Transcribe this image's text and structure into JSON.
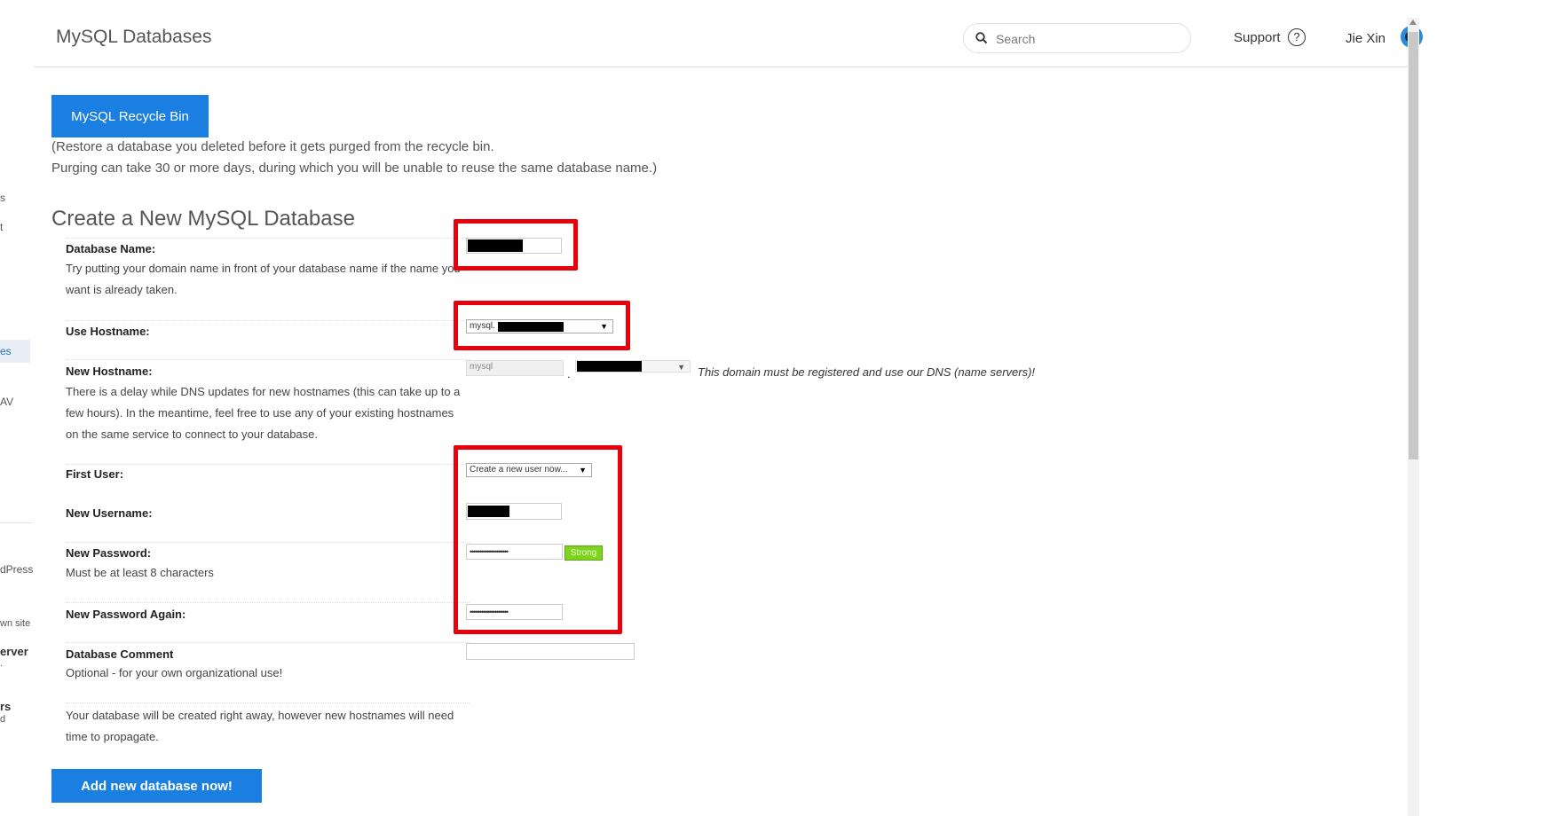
{
  "header": {
    "page_title": "MySQL Databases",
    "search_placeholder": "Search",
    "support_label": "Support",
    "support_icon_glyph": "?",
    "user_name": "Jie Xin"
  },
  "sidebar_fragments": [
    "s",
    "t",
    "es",
    "AV",
    "dPress",
    "wn site",
    "erver",
    ".",
    "rs",
    "d"
  ],
  "recycle": {
    "button_label": "MySQL Recycle Bin",
    "line1": "(Restore a database you deleted before it gets purged from the recycle bin.",
    "line2": "Purging can take 30 or more days, during which you will be unable to reuse the same database name.)"
  },
  "form": {
    "section_title": "Create a New MySQL Database",
    "database_name": {
      "label": "Database Name:",
      "help": "Try putting your domain name in front of your database name if the name you want is already taken."
    },
    "use_hostname": {
      "label": "Use Hostname:",
      "selected": "mysql."
    },
    "new_hostname": {
      "label": "New Hostname:",
      "help": "There is a delay while DNS updates for new hostnames (this can take up to a few hours). In the meantime, feel free to use any of your existing hostnames on the same service to connect to your database.",
      "prefix_value": "mysql",
      "dot": ".",
      "note": "This domain must be registered and use our DNS (name servers)!"
    },
    "first_user": {
      "label": "First User:",
      "selected": "Create a new user now..."
    },
    "new_username": {
      "label": "New Username:"
    },
    "new_password": {
      "label": "New Password:",
      "help": "Must be at least 8 characters",
      "value": "••••••••••••••••••••",
      "strength": "Strong"
    },
    "new_password_again": {
      "label": "New Password Again:",
      "value": "••••••••••••••••••••"
    },
    "database_comment": {
      "label": "Database Comment",
      "help": "Optional - for your own organizational use!",
      "value": ""
    },
    "footer_note": "Your database will be created right away, however new hostnames will need time to propagate.",
    "submit_label": "Add new database now!"
  },
  "colors": {
    "accent": "#1a7fe0",
    "highlight_red": "#e8000c",
    "strong_green": "#7ed321"
  }
}
